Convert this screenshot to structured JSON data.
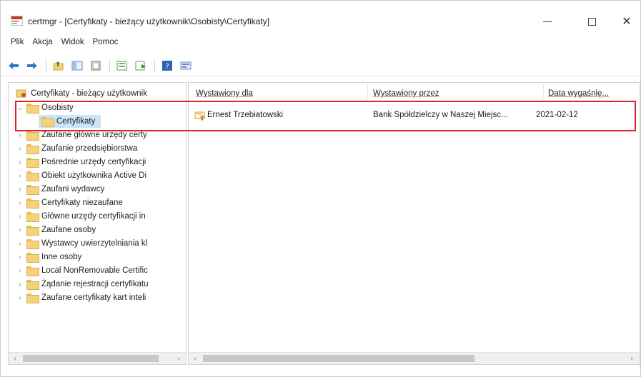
{
  "window": {
    "title": "certmgr - [Certyfikaty - bieżący użytkownik\\Osobisty\\Certyfikaty]",
    "minimize_glyph": "—",
    "maximize_glyph": "□",
    "close_glyph": "✕"
  },
  "menu": [
    "Plik",
    "Akcja",
    "Widok",
    "Pomoc"
  ],
  "toolbar": {
    "icons": [
      "back-arrow-icon",
      "forward-arrow-icon",
      "folder-up-icon",
      "show-tree-icon",
      "properties-icon",
      "export-list-icon",
      "refresh-icon",
      "help-icon",
      "console-view-icon"
    ]
  },
  "tree": {
    "root": "Certyfikaty - bieżący użytkownik",
    "items": [
      {
        "label": "Osobisty",
        "expander": "⌄",
        "level": 1
      },
      {
        "label": "Certyfikaty",
        "expander": "",
        "level": 2,
        "selected": true
      },
      {
        "label": "Zaufane główne urzędy certy",
        "expander": "›",
        "level": 1
      },
      {
        "label": "Zaufanie przedsiębiorstwa",
        "expander": "›",
        "level": 1
      },
      {
        "label": "Pośrednie urzędy certyfikacji",
        "expander": "›",
        "level": 1
      },
      {
        "label": "Obiekt użytkownika Active Di",
        "expander": "›",
        "level": 1
      },
      {
        "label": "Zaufani wydawcy",
        "expander": "›",
        "level": 1
      },
      {
        "label": "Certyfikaty niezaufane",
        "expander": "›",
        "level": 1
      },
      {
        "label": "Główne urzędy certyfikacji in",
        "expander": "›",
        "level": 1
      },
      {
        "label": "Zaufane osoby",
        "expander": "›",
        "level": 1
      },
      {
        "label": "Wystawcy uwierzytelniania kl",
        "expander": "›",
        "level": 1
      },
      {
        "label": "Inne osoby",
        "expander": "›",
        "level": 1
      },
      {
        "label": "Local NonRemovable Certific",
        "expander": "›",
        "level": 1
      },
      {
        "label": "Żądanie rejestracji certyfikatu",
        "expander": "›",
        "level": 1
      },
      {
        "label": "Zaufane certyfikaty kart inteli",
        "expander": "›",
        "level": 1
      }
    ]
  },
  "list": {
    "columns": [
      "Wystawiony dla",
      "Wystawiony przez",
      "Data wygaśnię..."
    ],
    "rows": [
      {
        "issued_to": "Ernest Trzebiatowski",
        "issued_by": "Bank Spółdzielczy w Naszej Miejsc...",
        "expires": "2021-02-12"
      }
    ]
  },
  "scroll": {
    "left_arrow": "‹",
    "right_arrow": "›"
  },
  "colors": {
    "selection": "#cce4f7",
    "highlight_border": "#e0202a"
  }
}
